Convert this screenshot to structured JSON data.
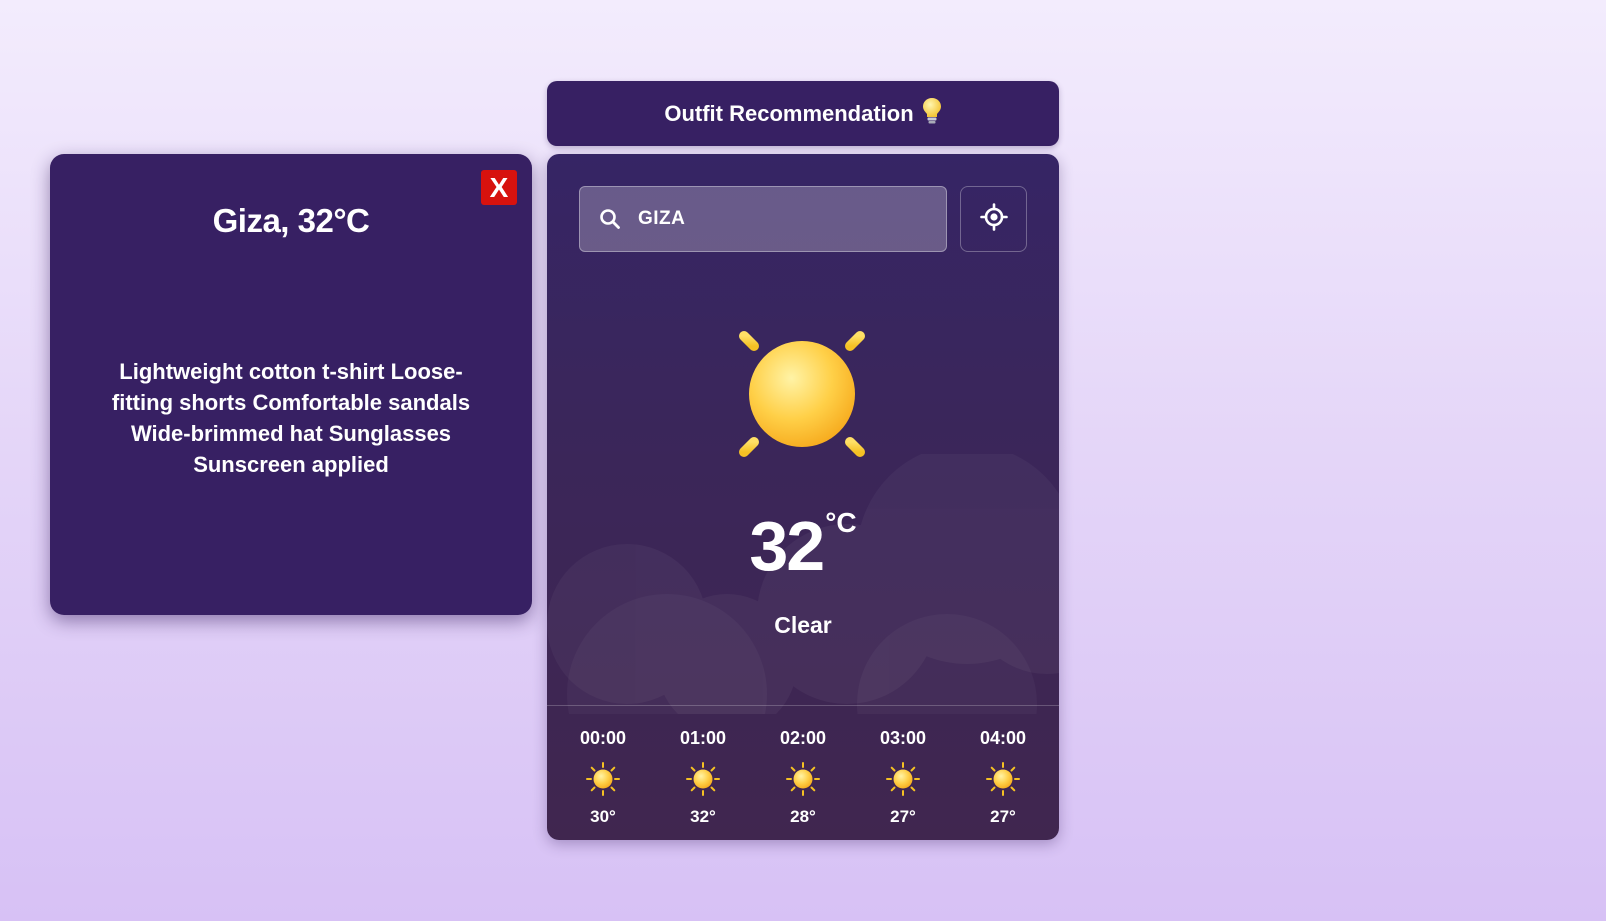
{
  "popup": {
    "title": "Giza, 32°C",
    "recommendation": "Lightweight cotton t-shirt Loose-fitting shorts Comfortable sandals Wide-brimmed hat Sunglasses Sunscreen applied",
    "close_label": "X"
  },
  "header": {
    "label": "Outfit Recommendation",
    "icon": "lightbulb-icon"
  },
  "search": {
    "value": "GIZA",
    "icon": "search-icon"
  },
  "location": {
    "icon": "crosshair-icon"
  },
  "weather": {
    "temperature": "32",
    "unit": "°C",
    "condition": "Clear",
    "icon": "sun-icon"
  },
  "forecast": [
    {
      "time": "00:00",
      "temp": "30°",
      "icon": "sun-icon"
    },
    {
      "time": "01:00",
      "temp": "32°",
      "icon": "sun-icon"
    },
    {
      "time": "02:00",
      "temp": "28°",
      "icon": "sun-icon"
    },
    {
      "time": "03:00",
      "temp": "27°",
      "icon": "sun-icon"
    },
    {
      "time": "04:00",
      "temp": "27°",
      "icon": "sun-icon"
    }
  ],
  "colors": {
    "card": "#372063",
    "close_button": "#d7120e",
    "sun": "#fbc936",
    "background": "#e4d5f8"
  }
}
